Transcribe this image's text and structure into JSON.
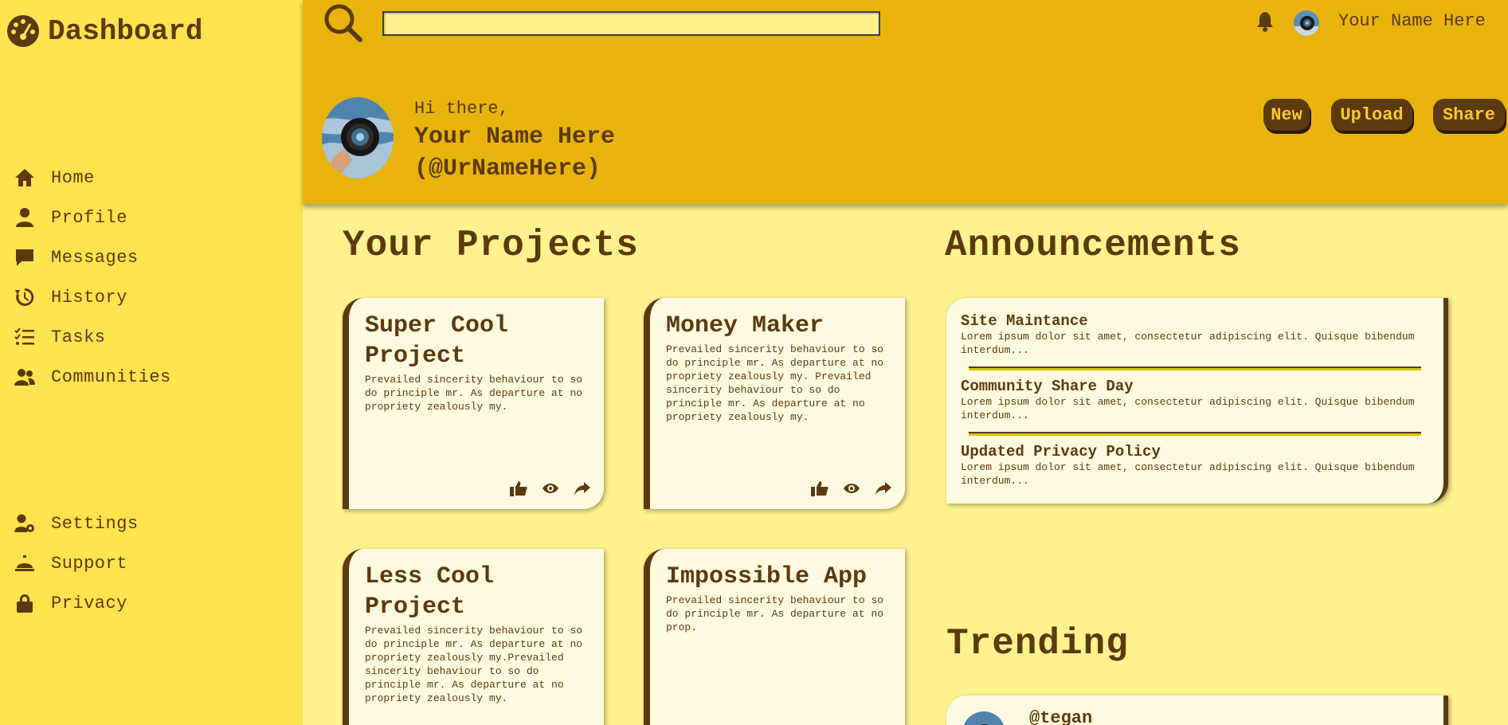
{
  "sidebar": {
    "brand": {
      "title": "Dashboard",
      "icon": "gauge-icon"
    },
    "main_items": [
      {
        "label": "Home",
        "icon": "home-icon"
      },
      {
        "label": "Profile",
        "icon": "user-icon"
      },
      {
        "label": "Messages",
        "icon": "message-icon"
      },
      {
        "label": "History",
        "icon": "history-icon"
      },
      {
        "label": "Tasks",
        "icon": "tasks-icon"
      },
      {
        "label": "Communities",
        "icon": "users-icon"
      }
    ],
    "bottom_items": [
      {
        "label": "Settings",
        "icon": "user-gear-icon"
      },
      {
        "label": "Support",
        "icon": "bell-service-icon"
      },
      {
        "label": "Privacy",
        "icon": "lock-icon"
      }
    ]
  },
  "header": {
    "search": {
      "value": "",
      "placeholder": ""
    },
    "user_name": "Your Name Here",
    "greeting": "Hi there,",
    "display_name": "Your Name Here",
    "handle": "(@UrNameHere)",
    "buttons": {
      "new": "New",
      "upload": "Upload",
      "share": "Share"
    }
  },
  "projects": {
    "title": "Your Projects",
    "cards": [
      {
        "title": "Super Cool Project",
        "description": "Prevailed sincerity behaviour to so do principle mr. As departure at no propriety zealously my."
      },
      {
        "title": "Money Maker",
        "description": "Prevailed sincerity behaviour to so do principle mr. As departure at no propriety zealously my. Prevailed sincerity behaviour to so do principle mr. As departure at no propriety zealously my."
      },
      {
        "title": "Less Cool Project",
        "description": "Prevailed sincerity behaviour to so do principle mr. As departure at no propriety zealously my.Prevailed sincerity behaviour to so do principle mr. As departure at no propriety zealously my."
      },
      {
        "title": "Impossible App",
        "description": "Prevailed sincerity behaviour to so do principle mr. As departure at no prop."
      }
    ]
  },
  "announcements": {
    "title": "Announcements",
    "items": [
      {
        "title": "Site Maintance",
        "body": "Lorem ipsum dolor sit amet, consectetur adipiscing elit. Quisque bibendum interdum..."
      },
      {
        "title": "Community Share Day",
        "body": "Lorem ipsum dolor sit amet, consectetur adipiscing elit. Quisque bibendum interdum..."
      },
      {
        "title": "Updated Privacy Policy",
        "body": "Lorem ipsum dolor sit amet, consectetur adipiscing elit. Quisque bibendum interdum..."
      }
    ]
  },
  "trending": {
    "title": "Trending",
    "items": [
      {
        "handle": "@tegan"
      }
    ]
  },
  "colors": {
    "sidebar_bg": "#ffe34f",
    "header_bg": "#e8b40c",
    "main_bg": "#fff28f",
    "card_bg": "#fffbe0",
    "brown": "#5c3a0e",
    "button_text": "#ffc926"
  }
}
